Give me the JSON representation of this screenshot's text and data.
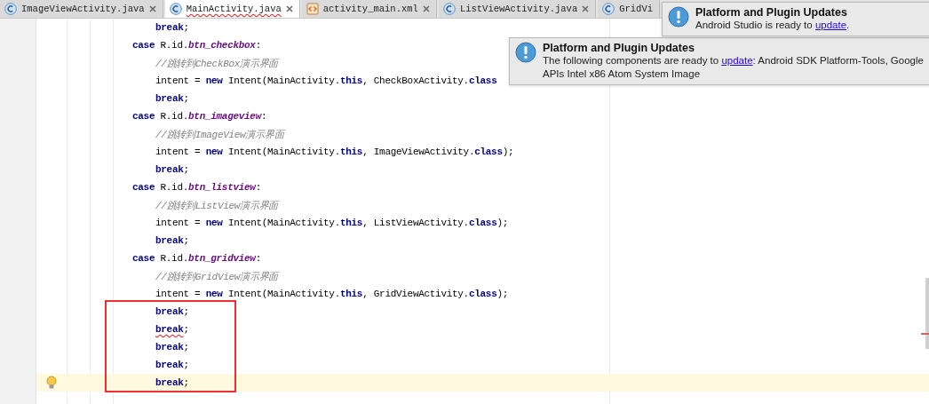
{
  "tabs": [
    {
      "label": "ImageViewActivity.java",
      "kind": "java",
      "selected": false,
      "error": false
    },
    {
      "label": "MainActivity.java",
      "kind": "java",
      "selected": true,
      "error": true
    },
    {
      "label": "activity_main.xml",
      "kind": "xml",
      "selected": false,
      "error": false
    },
    {
      "label": "ListViewActivity.java",
      "kind": "java",
      "selected": false,
      "error": false
    },
    {
      "label": "GridVi",
      "kind": "java",
      "selected": false,
      "error": false
    }
  ],
  "notifications": [
    {
      "title": "Platform and Plugin Updates",
      "before": "Android Studio is ready to ",
      "link": "update",
      "after": "."
    },
    {
      "title": "Platform and Plugin Updates",
      "before": "The following components are ready to ",
      "link": "update",
      "after": ": Android SDK Platform-Tools, Google APIs Intel x86 Atom System Image"
    }
  ],
  "code_lines": [
    {
      "kind": "body",
      "error": false,
      "current": false,
      "tokens": [
        {
          "kind": "keyword",
          "text": "break"
        },
        {
          "kind": "plain",
          "text": ";"
        }
      ]
    },
    {
      "kind": "case",
      "error": false,
      "current": false,
      "tokens": [
        {
          "kind": "keyword",
          "text": "case "
        },
        {
          "kind": "plain",
          "text": "R.id."
        },
        {
          "kind": "field",
          "text": "btn_checkbox"
        },
        {
          "kind": "plain",
          "text": ":"
        }
      ]
    },
    {
      "kind": "body",
      "error": false,
      "current": false,
      "tokens": [
        {
          "kind": "comment",
          "text": "//跳转到CheckBox演示界面"
        }
      ]
    },
    {
      "kind": "body",
      "error": false,
      "current": false,
      "tokens": [
        {
          "kind": "plain",
          "text": "intent = "
        },
        {
          "kind": "keyword",
          "text": "new "
        },
        {
          "kind": "plain",
          "text": "Intent(MainActivity."
        },
        {
          "kind": "keyword",
          "text": "this"
        },
        {
          "kind": "plain",
          "text": ", CheckBoxActivity."
        },
        {
          "kind": "keyword",
          "text": "class"
        }
      ]
    },
    {
      "kind": "body",
      "error": false,
      "current": false,
      "tokens": [
        {
          "kind": "keyword",
          "text": "break"
        },
        {
          "kind": "plain",
          "text": ";"
        }
      ]
    },
    {
      "kind": "case",
      "error": false,
      "current": false,
      "tokens": [
        {
          "kind": "keyword",
          "text": "case "
        },
        {
          "kind": "plain",
          "text": "R.id."
        },
        {
          "kind": "field",
          "text": "btn_imageview"
        },
        {
          "kind": "plain",
          "text": ":"
        }
      ]
    },
    {
      "kind": "body",
      "error": false,
      "current": false,
      "tokens": [
        {
          "kind": "comment",
          "text": "//跳转到ImageView演示界面"
        }
      ]
    },
    {
      "kind": "body",
      "error": false,
      "current": false,
      "tokens": [
        {
          "kind": "plain",
          "text": "intent = "
        },
        {
          "kind": "keyword",
          "text": "new "
        },
        {
          "kind": "plain",
          "text": "Intent(MainActivity."
        },
        {
          "kind": "keyword",
          "text": "this"
        },
        {
          "kind": "plain",
          "text": ", ImageViewActivity."
        },
        {
          "kind": "keyword",
          "text": "class"
        },
        {
          "kind": "plain",
          "text": ");"
        }
      ]
    },
    {
      "kind": "body",
      "error": false,
      "current": false,
      "tokens": [
        {
          "kind": "keyword",
          "text": "break"
        },
        {
          "kind": "plain",
          "text": ";"
        }
      ]
    },
    {
      "kind": "case",
      "error": false,
      "current": false,
      "tokens": [
        {
          "kind": "keyword",
          "text": "case "
        },
        {
          "kind": "plain",
          "text": "R.id."
        },
        {
          "kind": "field",
          "text": "btn_listview"
        },
        {
          "kind": "plain",
          "text": ":"
        }
      ]
    },
    {
      "kind": "body",
      "error": false,
      "current": false,
      "tokens": [
        {
          "kind": "comment",
          "text": "//跳转到ListView演示界面"
        }
      ]
    },
    {
      "kind": "body",
      "error": false,
      "current": false,
      "tokens": [
        {
          "kind": "plain",
          "text": "intent = "
        },
        {
          "kind": "keyword",
          "text": "new "
        },
        {
          "kind": "plain",
          "text": "Intent(MainActivity."
        },
        {
          "kind": "keyword",
          "text": "this"
        },
        {
          "kind": "plain",
          "text": ", ListViewActivity."
        },
        {
          "kind": "keyword",
          "text": "class"
        },
        {
          "kind": "plain",
          "text": ");"
        }
      ]
    },
    {
      "kind": "body",
      "error": false,
      "current": false,
      "tokens": [
        {
          "kind": "keyword",
          "text": "break"
        },
        {
          "kind": "plain",
          "text": ";"
        }
      ]
    },
    {
      "kind": "case",
      "error": false,
      "current": false,
      "tokens": [
        {
          "kind": "keyword",
          "text": "case "
        },
        {
          "kind": "plain",
          "text": "R.id."
        },
        {
          "kind": "field",
          "text": "btn_gridview"
        },
        {
          "kind": "plain",
          "text": ":"
        }
      ]
    },
    {
      "kind": "body",
      "error": false,
      "current": false,
      "tokens": [
        {
          "kind": "comment",
          "text": "//跳转到GridView演示界面"
        }
      ]
    },
    {
      "kind": "body",
      "error": false,
      "current": false,
      "tokens": [
        {
          "kind": "plain",
          "text": "intent = "
        },
        {
          "kind": "keyword",
          "text": "new "
        },
        {
          "kind": "plain",
          "text": "Intent(MainActivity."
        },
        {
          "kind": "keyword",
          "text": "this"
        },
        {
          "kind": "plain",
          "text": ", GridViewActivity."
        },
        {
          "kind": "keyword",
          "text": "class"
        },
        {
          "kind": "plain",
          "text": ");"
        }
      ]
    },
    {
      "kind": "body",
      "error": false,
      "current": false,
      "tokens": [
        {
          "kind": "keyword",
          "text": "break"
        },
        {
          "kind": "plain",
          "text": ";"
        }
      ]
    },
    {
      "kind": "body",
      "error": true,
      "current": false,
      "tokens": [
        {
          "kind": "keyword",
          "text": "break"
        },
        {
          "kind": "plain",
          "text": ";"
        }
      ]
    },
    {
      "kind": "body",
      "error": false,
      "current": false,
      "tokens": [
        {
          "kind": "keyword",
          "text": "break"
        },
        {
          "kind": "plain",
          "text": ";"
        }
      ]
    },
    {
      "kind": "body",
      "error": false,
      "current": false,
      "tokens": [
        {
          "kind": "keyword",
          "text": "break"
        },
        {
          "kind": "plain",
          "text": ";"
        }
      ]
    },
    {
      "kind": "body",
      "error": false,
      "current": true,
      "tokens": [
        {
          "kind": "keyword",
          "text": "break"
        },
        {
          "kind": "plain",
          "text": ";"
        }
      ]
    }
  ]
}
